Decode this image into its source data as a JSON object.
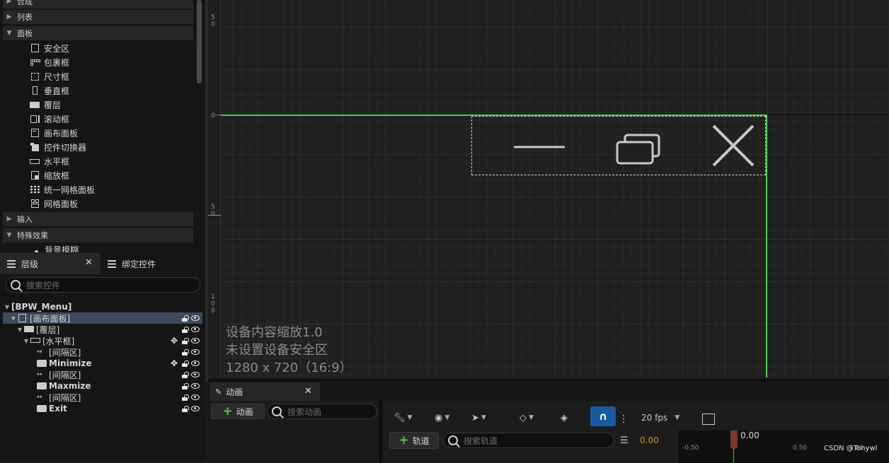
{
  "palette": {
    "categories": [
      {
        "label": "合成",
        "expanded": false
      },
      {
        "label": "列表",
        "expanded": false
      },
      {
        "label": "面板",
        "expanded": true
      },
      {
        "label": "输入",
        "expanded": false
      },
      {
        "label": "特殊效果",
        "expanded": true
      }
    ],
    "items": [
      {
        "label": "安全区",
        "icon": "safezone-icon"
      },
      {
        "label": "包裹框",
        "icon": "wrapbox-icon"
      },
      {
        "label": "尺寸框",
        "icon": "sizebox-icon"
      },
      {
        "label": "垂直框",
        "icon": "verticalbox-icon"
      },
      {
        "label": "覆层",
        "icon": "overlay-icon"
      },
      {
        "label": "滚动框",
        "icon": "scrollbox-icon"
      },
      {
        "label": "画布面板",
        "icon": "canvas-panel-icon"
      },
      {
        "label": "控件切换器",
        "icon": "widget-switcher-icon"
      },
      {
        "label": "水平框",
        "icon": "horizontalbox-icon"
      },
      {
        "label": "缩放框",
        "icon": "scalebox-icon"
      },
      {
        "label": "统一网格面板",
        "icon": "uniform-grid-icon"
      },
      {
        "label": "网格面板",
        "icon": "grid-panel-icon"
      }
    ],
    "partial_item": "背景模糊"
  },
  "hierarchy": {
    "tab_label": "层级",
    "bind_tab_label": "绑定控件",
    "search_placeholder": "搜索控件",
    "rows": [
      {
        "label": "[BPW_Menu]",
        "level": 0,
        "expander": "open",
        "icon": "",
        "bold": true,
        "selected": false,
        "move": false,
        "lock": false,
        "eye": false
      },
      {
        "label": "[画布面板]",
        "level": 1,
        "expander": "open",
        "icon": "canvas-panel-icon",
        "bold": false,
        "selected": true,
        "move": false,
        "lock": true,
        "eye": true
      },
      {
        "label": "[覆层]",
        "level": 2,
        "expander": "open",
        "icon": "overlay-icon",
        "bold": false,
        "selected": false,
        "move": false,
        "lock": true,
        "eye": true
      },
      {
        "label": "[水平框]",
        "level": 3,
        "expander": "open",
        "icon": "horizontalbox-icon",
        "bold": false,
        "selected": false,
        "move": true,
        "lock": true,
        "eye": true
      },
      {
        "label": "[间隔区]",
        "level": 4,
        "expander": "none",
        "icon": "spacer-icon",
        "bold": false,
        "selected": false,
        "move": false,
        "lock": true,
        "eye": true
      },
      {
        "label": "Minimize",
        "level": 4,
        "expander": "none",
        "icon": "button-icon",
        "bold": true,
        "selected": false,
        "move": true,
        "lock": true,
        "eye": true
      },
      {
        "label": "[间隔区]",
        "level": 4,
        "expander": "none",
        "icon": "spacer-icon",
        "bold": false,
        "selected": false,
        "move": false,
        "lock": true,
        "eye": true
      },
      {
        "label": "Maxmize",
        "level": 4,
        "expander": "none",
        "icon": "button-icon",
        "bold": true,
        "selected": false,
        "move": false,
        "lock": true,
        "eye": true
      },
      {
        "label": "[间隔区]",
        "level": 4,
        "expander": "none",
        "icon": "spacer-icon",
        "bold": false,
        "selected": false,
        "move": false,
        "lock": true,
        "eye": true
      },
      {
        "label": "Exit",
        "level": 4,
        "expander": "none",
        "icon": "button-icon",
        "bold": true,
        "selected": false,
        "move": false,
        "lock": true,
        "eye": true
      }
    ]
  },
  "ruler": {
    "labels": [
      {
        "text": "5\n0"
      },
      {
        "text": "0"
      },
      {
        "text": "5\n0"
      },
      {
        "text": "1\n0\n0"
      }
    ]
  },
  "canvas": {
    "info_lines": [
      "设备内容缩放1.0",
      "未设置设备安全区",
      "1280 x 720（16:9）"
    ],
    "window_buttons": [
      "minimize-icon",
      "maximize-icon",
      "close-icon"
    ],
    "accent": "#2ee02e"
  },
  "animation": {
    "tab_label": "动画",
    "add_label": "动画",
    "search_placeholder": "搜索动画",
    "track_label": "轨道",
    "track_search_placeholder": "搜索轨道",
    "fps": "20 fps",
    "time_value": "0.00",
    "playhead_value": "0.00",
    "timeline_ticks": [
      "-0.50",
      "0.50",
      "1.00"
    ],
    "watermark": "CSDN @Tonywl"
  }
}
